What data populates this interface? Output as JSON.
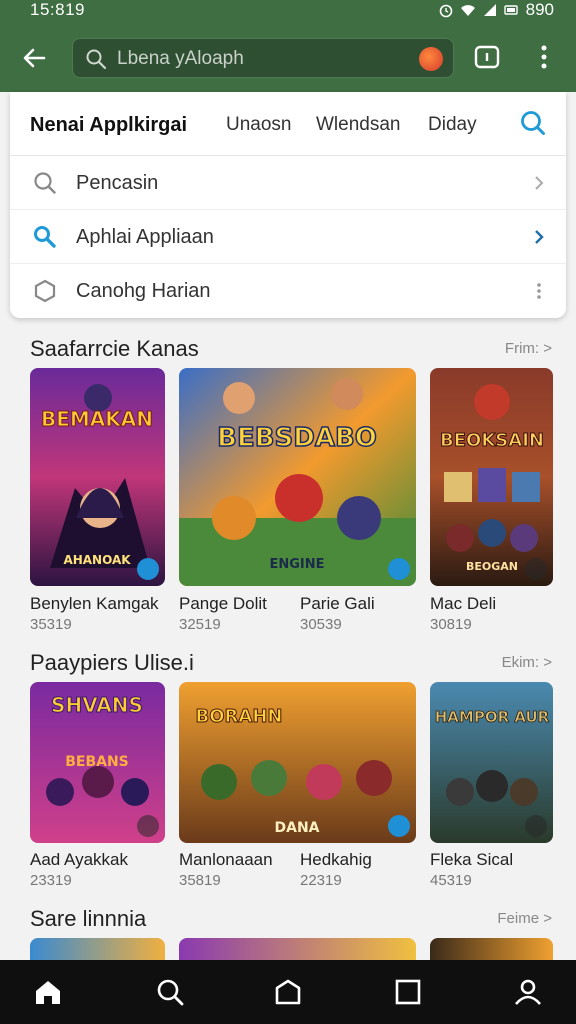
{
  "status": {
    "time": "15:819",
    "battery": "890"
  },
  "appbar": {
    "search_placeholder": "Lbena yAloaph",
    "icons": [
      "back-arrow-icon",
      "search-icon",
      "voice-icon",
      "tab-switch-icon",
      "more-vert-icon"
    ]
  },
  "dropdown": {
    "tabs": [
      "Nenai Applkirgai",
      "Unaosn",
      "Wlendsan",
      "Diday"
    ],
    "items": [
      {
        "label": "Pencasin",
        "icon": "search-icon"
      },
      {
        "label": "Aphlai Appliaan",
        "icon": "search-icon"
      },
      {
        "label": "Canohg Harian",
        "icon": "hexagon-icon"
      }
    ]
  },
  "sections": [
    {
      "title": "Saafarrcie Kanas",
      "more": "Frim: >",
      "apps": [
        {
          "name": "Benylen Kamgak",
          "count": "35319",
          "art": "BEMAKAN",
          "subart": "AHANOAK"
        },
        {
          "name": "Pange Dolit",
          "count": "32519",
          "art": "BEBSDABO",
          "subart": "ENGINE"
        },
        {
          "name": "Parie Gali",
          "count": "30539"
        },
        {
          "name": "Mac Deli",
          "count": "30819",
          "art": "BEOKSAIN",
          "subart": "BEOGAN"
        }
      ]
    },
    {
      "title": "Paaypiers Ulise.i",
      "more": "Ekim: >",
      "apps": [
        {
          "name": "Aad Ayakkak",
          "count": "23319",
          "art": "SHVANS",
          "subart": "BEBANS"
        },
        {
          "name": "Manlonaaan",
          "count": "35819",
          "art": "BORAHN",
          "subart": "DANA"
        },
        {
          "name": "Hedkahig",
          "count": "22319"
        },
        {
          "name": "Fleka Sical",
          "count": "45319",
          "art": "HAMPOR AUR"
        }
      ]
    },
    {
      "title": "Sare linnnia",
      "more": "Feime >"
    }
  ],
  "colors": {
    "appbar": "#3f6e42",
    "accent": "#1f8fd6",
    "nav": "#0f0f0f"
  },
  "bottom_nav": [
    "home-icon",
    "search-icon",
    "library-icon",
    "square-icon",
    "account-icon"
  ]
}
